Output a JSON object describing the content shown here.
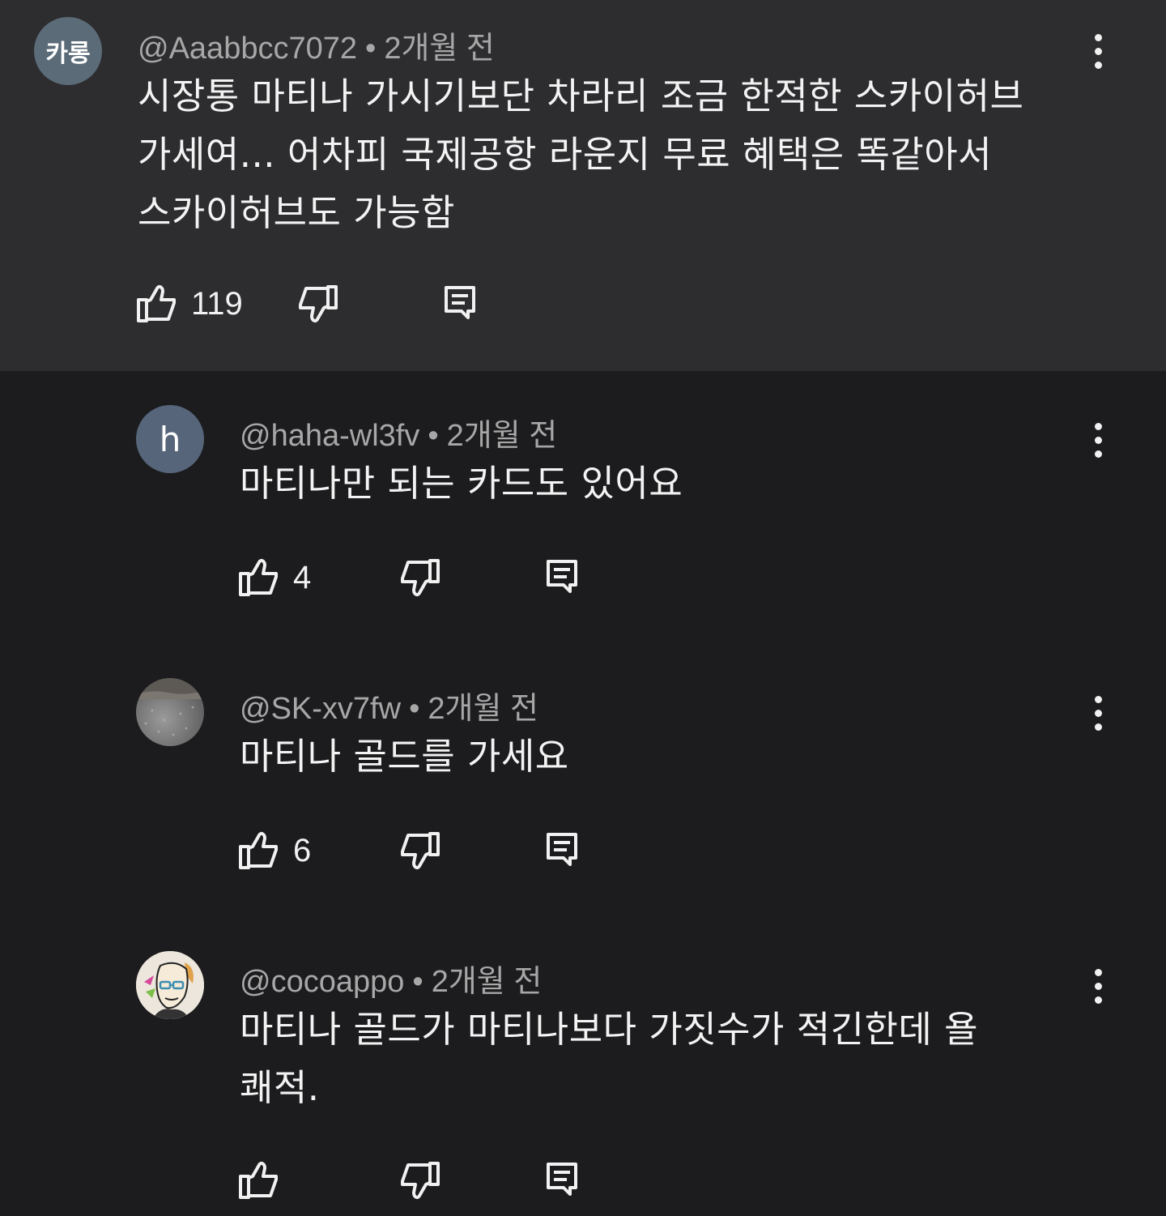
{
  "comments": [
    {
      "author": "@Aaabbcc7072",
      "avatar_text": "카롱",
      "time": "2개월 전",
      "text": "시장통 마티나 가시기보단 차라리 조금 한적한 스카이허브\n가세여... 어차피 국제공항 라운지 무료 혜택은 똑같아서\n스카이허브도 가능함",
      "likes": "119"
    },
    {
      "author": "@haha-wl3fv",
      "avatar_text": "h",
      "time": "2개월 전",
      "text": "마티나만 되는 카드도 있어요",
      "likes": "4"
    },
    {
      "author": "@SK-xv7fw",
      "time": "2개월 전",
      "text": "마티나 골드를 가세요",
      "likes": "6"
    },
    {
      "author": "@cocoappo",
      "time": "2개월 전",
      "text": "마티나 골드가 마티나보다 가짓수가 적긴한데 욜\n쾌적.",
      "likes": ""
    }
  ],
  "separator": "•"
}
